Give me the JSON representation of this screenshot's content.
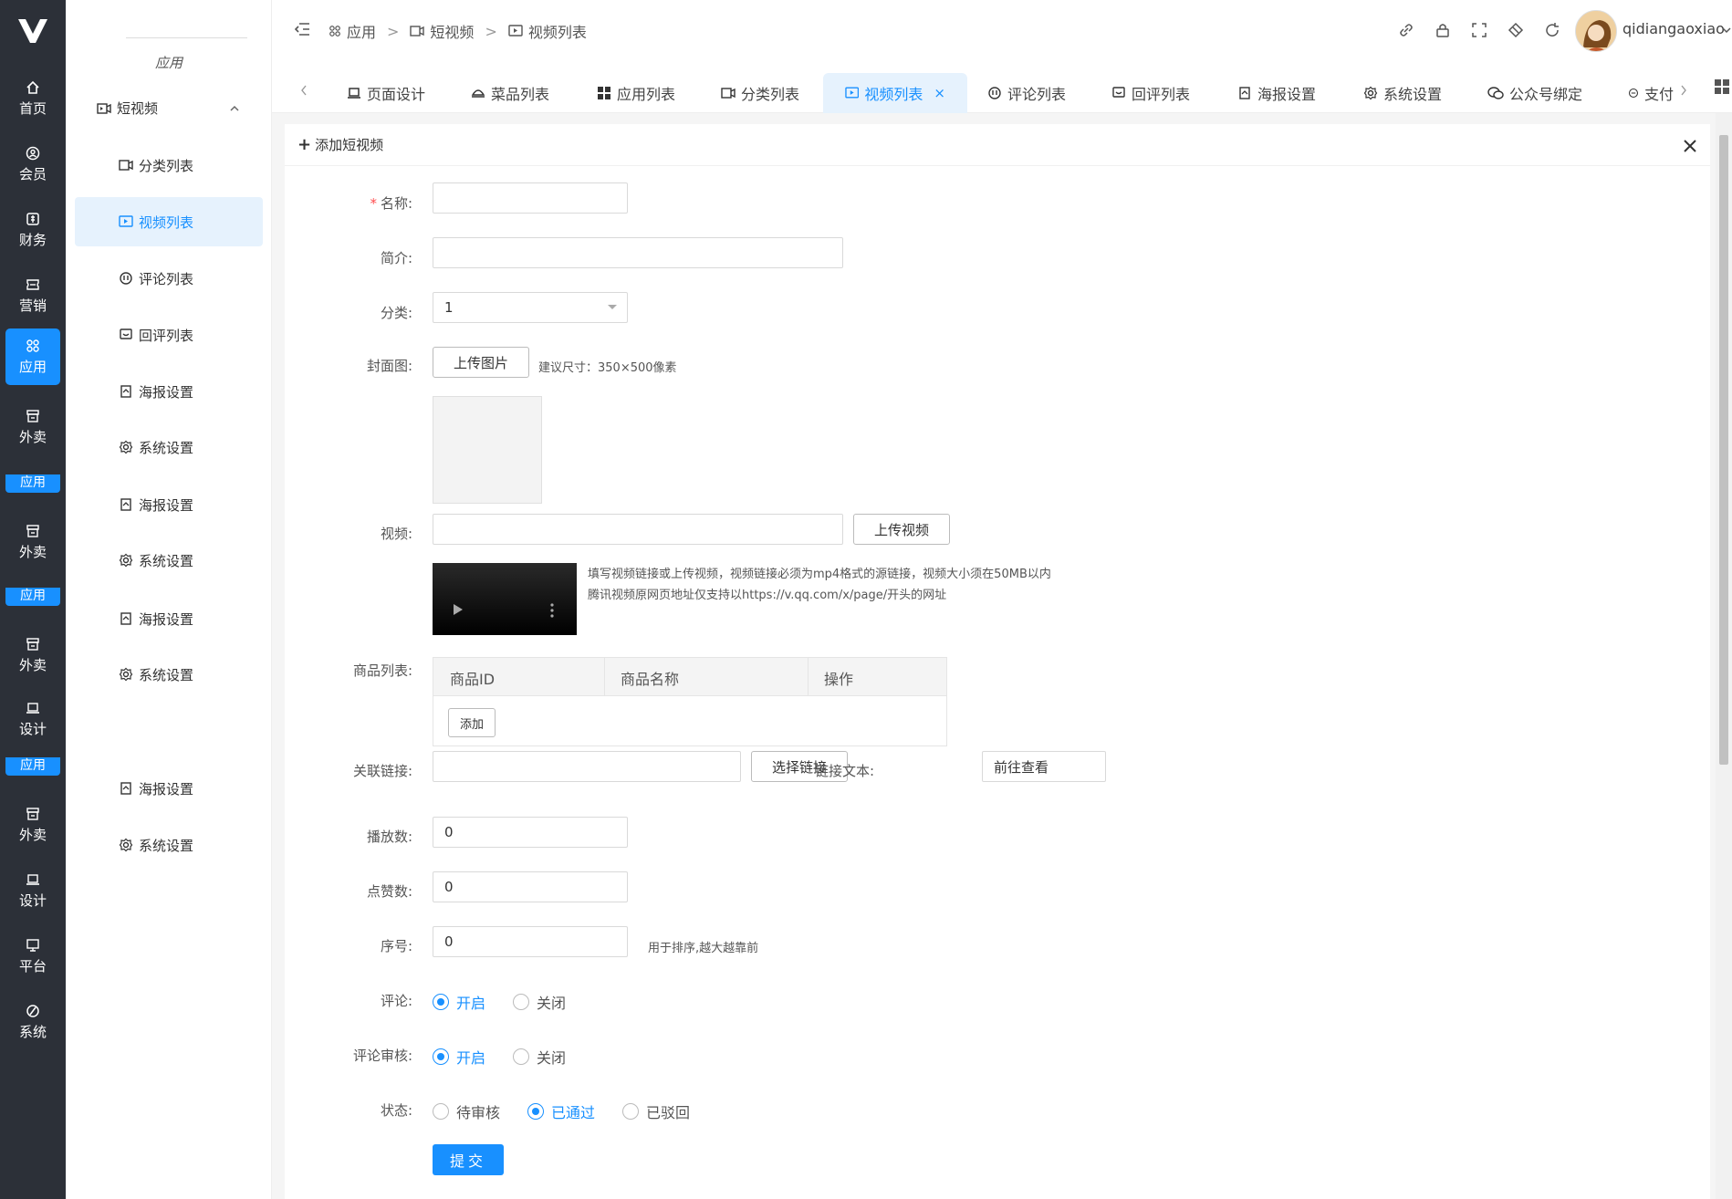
{
  "leftbar": {
    "items": [
      {
        "label": "首页",
        "icon": "home-icon"
      },
      {
        "label": "会员",
        "icon": "user-icon"
      },
      {
        "label": "财务",
        "icon": "money-icon"
      },
      {
        "label": "营销",
        "icon": "ticket-icon"
      },
      {
        "label": "应用",
        "icon": "apps-icon",
        "active": true
      },
      {
        "label": "外卖",
        "icon": "store-icon"
      },
      {
        "label": "外卖",
        "icon": "store-icon"
      },
      {
        "label": "外卖",
        "icon": "store-icon"
      },
      {
        "label": "设计",
        "icon": "laptop-icon"
      },
      {
        "label": "外卖",
        "icon": "store-icon"
      },
      {
        "label": "设计",
        "icon": "laptop-icon"
      },
      {
        "label": "平台",
        "icon": "monitor-icon"
      },
      {
        "label": "系统",
        "icon": "system-icon"
      }
    ],
    "stub_label": "应用"
  },
  "subnav": {
    "title": "应用",
    "group": "短视频",
    "items": [
      {
        "label": "分类列表"
      },
      {
        "label": "视频列表",
        "active": true
      },
      {
        "label": "评论列表"
      },
      {
        "label": "回评列表"
      },
      {
        "label": "海报设置"
      },
      {
        "label": "系统设置"
      },
      {
        "label": "海报设置"
      },
      {
        "label": "系统设置"
      },
      {
        "label": "海报设置"
      },
      {
        "label": "系统设置"
      },
      {
        "label": "海报设置"
      },
      {
        "label": "系统设置"
      }
    ]
  },
  "header": {
    "breadcrumb": [
      "应用",
      "短视频",
      "视频列表"
    ],
    "username": "qidiangaoxiao"
  },
  "tabs": [
    {
      "label": "页面设计"
    },
    {
      "label": "菜品列表"
    },
    {
      "label": "应用列表"
    },
    {
      "label": "分类列表"
    },
    {
      "label": "视频列表",
      "active": true
    },
    {
      "label": "评论列表"
    },
    {
      "label": "回评列表"
    },
    {
      "label": "海报设置"
    },
    {
      "label": "系统设置"
    },
    {
      "label": "公众号绑定"
    },
    {
      "label": "支付"
    }
  ],
  "form": {
    "panel_title": "添加短视频",
    "name_label": "名称:",
    "intro_label": "简介:",
    "category_label": "分类:",
    "category_value": "1",
    "cover_label": "封面图:",
    "upload_image": "上传图片",
    "cover_hint": "建议尺寸：350×500像素",
    "video_label": "视频:",
    "upload_video": "上传视频",
    "video_hint_1": "填写视频链接或上传视频，视频链接必须为mp4格式的源链接，视频大小须在50MB以内",
    "video_hint_2": "腾讯视频原网页地址仅支持以https://v.qq.com/x/page/开头的网址",
    "goods_label": "商品列表:",
    "goods_cols": [
      "商品ID",
      "商品名称",
      "操作"
    ],
    "add_btn": "添加",
    "link_label": "关联链接:",
    "choose_link": "选择链接",
    "link_text_label": "链接文本:",
    "link_text_value": "前往查看",
    "plays_label": "播放数:",
    "plays_value": "0",
    "likes_label": "点赞数:",
    "likes_value": "0",
    "sort_label": "序号:",
    "sort_value": "0",
    "sort_hint": "用于排序,越大越靠前",
    "comment_label": "评论:",
    "comment_opts": [
      "开启",
      "关闭"
    ],
    "audit_label": "评论审核:",
    "audit_opts": [
      "开启",
      "关闭"
    ],
    "status_label": "状态:",
    "status_opts": [
      "待审核",
      "已通过",
      "已驳回"
    ],
    "submit": "提交"
  }
}
